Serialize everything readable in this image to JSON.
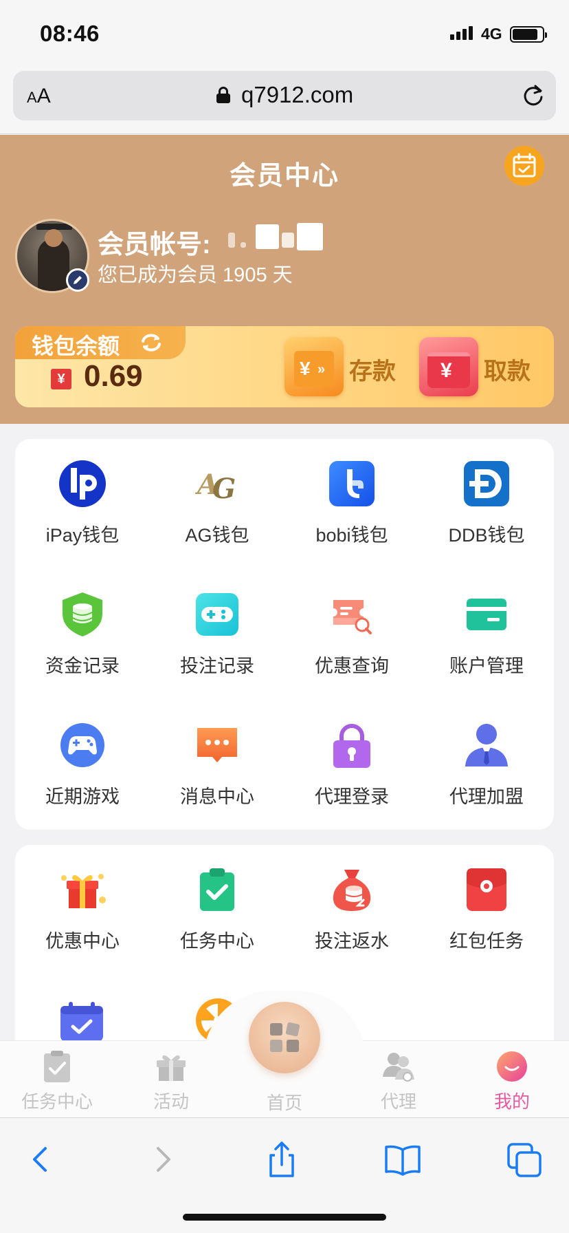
{
  "status_bar": {
    "time": "08:46",
    "network": "4G"
  },
  "browser": {
    "text_size_small": "A",
    "text_size_large": "A",
    "url": "q7912.com"
  },
  "header": {
    "title": "会员中心",
    "account_label": "会员帐号:",
    "member_days": "您已成为会员 1905 天"
  },
  "wallet": {
    "label": "钱包余额",
    "currency_symbol": "¥",
    "balance": "0.69",
    "deposit_label": "存款",
    "deposit_icon_text": "¥",
    "withdraw_label": "取款",
    "withdraw_icon_text": "¥"
  },
  "grid_top": [
    {
      "label": "iPay钱包",
      "icon": "ipay-icon"
    },
    {
      "label": "AG钱包",
      "icon": "ag-icon"
    },
    {
      "label": "bobi钱包",
      "icon": "bobi-icon"
    },
    {
      "label": "DDB钱包",
      "icon": "ddb-icon"
    },
    {
      "label": "资金记录",
      "icon": "coin-shield-icon"
    },
    {
      "label": "投注记录",
      "icon": "gamepad-icon"
    },
    {
      "label": "优惠查询",
      "icon": "coupon-search-icon"
    },
    {
      "label": "账户管理",
      "icon": "card-icon"
    },
    {
      "label": "近期游戏",
      "icon": "controller-icon"
    },
    {
      "label": "消息中心",
      "icon": "message-icon"
    },
    {
      "label": "代理登录",
      "icon": "lock-icon"
    },
    {
      "label": "代理加盟",
      "icon": "agent-icon"
    }
  ],
  "grid_bottom": [
    {
      "label": "优惠中心",
      "icon": "gift-icon"
    },
    {
      "label": "任务中心",
      "icon": "clipboard-check-icon"
    },
    {
      "label": "投注返水",
      "icon": "money-bag-icon"
    },
    {
      "label": "红包任务",
      "icon": "red-envelope-icon"
    }
  ],
  "tabbar": {
    "tasks": "任务中心",
    "activity": "活动",
    "home": "首页",
    "agent": "代理",
    "mine": "我的"
  },
  "colors": {
    "header_bg": "#d0a37b",
    "accent_pink": "#e55ba0",
    "ios_blue": "#1a7cf5"
  }
}
